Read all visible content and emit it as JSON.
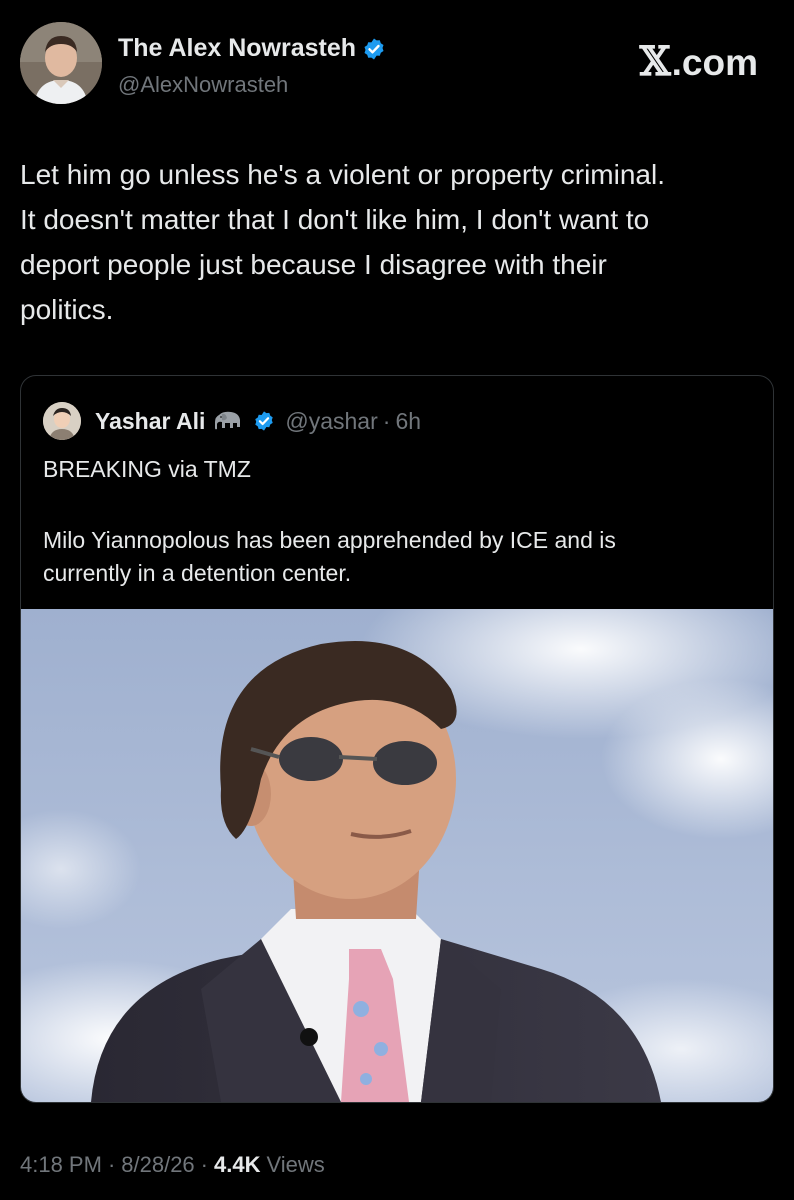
{
  "author": {
    "display_name": "The Alex Nowrasteh",
    "handle": "@AlexNowrasteh",
    "verified_icon": "verified-badge-icon",
    "avatar_icon": "profile-photo"
  },
  "brand": {
    "x_glyph": "𝕏",
    "suffix": ".com"
  },
  "tweet": {
    "lines": [
      "Let him go unless he's a violent or property criminal.",
      "It doesn't matter that I don't like him, I don't want to",
      "deport people just because I disagree with their",
      "politics."
    ]
  },
  "quoted": {
    "display_name": "Yashar Ali",
    "emoji_icon": "elephant-icon",
    "handle": "@yashar",
    "separator": "·",
    "time": "6h",
    "line1": "BREAKING via TMZ",
    "body_lines": [
      "Milo Yiannopolous has been apprehended by ICE and is",
      "currently in a detention center."
    ],
    "image_icon": "news-photo"
  },
  "footer": {
    "time": "4:18 PM",
    "sep": "·",
    "date": "8/28/26",
    "views_count": "4.4K",
    "views_label": "Views"
  },
  "colors": {
    "background": "#000000",
    "text": "#e7e9ea",
    "secondary": "#71767b",
    "verified": "#1d9bf0",
    "border": "#2f3336"
  }
}
